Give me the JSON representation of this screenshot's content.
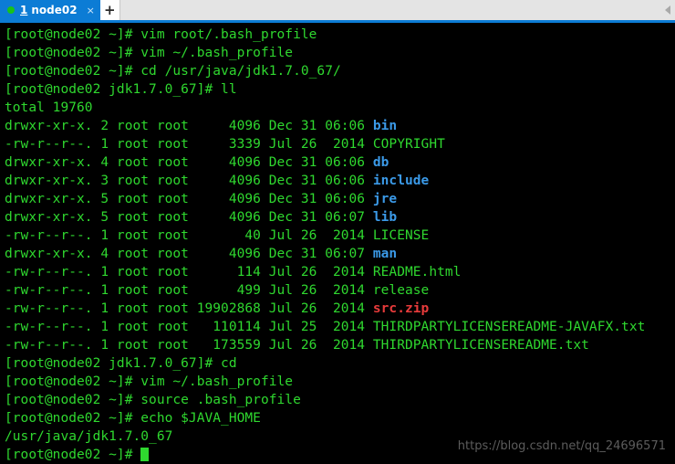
{
  "window": {
    "tabbar": {
      "tabs": [
        {
          "index": "1",
          "title": "node02",
          "close_label": "×",
          "status_icon": "green-dot"
        }
      ],
      "new_tab_label": "+",
      "scroll_arrow_icon": "chevron-left-icon"
    },
    "colors": {
      "tab_active_bg": "#0c7cd5",
      "tabbar_bg": "#e4e4e4",
      "terminal_bg": "#000000",
      "text_green": "#2fd82f",
      "dir_blue": "#3b9ae8",
      "archive_red": "#e83b3b",
      "status_dot": "#19c319"
    }
  },
  "terminal": {
    "prompt_user_host_home": "[root@node02 ~]# ",
    "prompt_user_host_jdk": "[root@node02 jdk1.7.0_67]# ",
    "lines": [
      {
        "text": "[root@node02 ~]# vim root/.bash_profile",
        "class": "g"
      },
      {
        "text": "[root@node02 ~]# vim ~/.bash_profile",
        "class": "g"
      },
      {
        "text": "[root@node02 ~]# cd /usr/java/jdk1.7.0_67/",
        "class": "g"
      },
      {
        "text": "[root@node02 jdk1.7.0_67]# ll",
        "class": "g"
      },
      {
        "text": "total 19760",
        "class": "g"
      }
    ],
    "listing": {
      "total_line": "total 19760",
      "rows": [
        {
          "perms": "drwxr-xr-x.",
          "links": "2",
          "owner": "root",
          "group": "root",
          "size": "4096",
          "month": "Dec",
          "day": "31",
          "time": "06:06",
          "name": "bin",
          "name_class": "b"
        },
        {
          "perms": "-rw-r--r--.",
          "links": "1",
          "owner": "root",
          "group": "root",
          "size": "3339",
          "month": "Jul",
          "day": "26",
          "time": "2014",
          "name": "COPYRIGHT",
          "name_class": "g"
        },
        {
          "perms": "drwxr-xr-x.",
          "links": "4",
          "owner": "root",
          "group": "root",
          "size": "4096",
          "month": "Dec",
          "day": "31",
          "time": "06:06",
          "name": "db",
          "name_class": "b"
        },
        {
          "perms": "drwxr-xr-x.",
          "links": "3",
          "owner": "root",
          "group": "root",
          "size": "4096",
          "month": "Dec",
          "day": "31",
          "time": "06:06",
          "name": "include",
          "name_class": "b"
        },
        {
          "perms": "drwxr-xr-x.",
          "links": "5",
          "owner": "root",
          "group": "root",
          "size": "4096",
          "month": "Dec",
          "day": "31",
          "time": "06:06",
          "name": "jre",
          "name_class": "b"
        },
        {
          "perms": "drwxr-xr-x.",
          "links": "5",
          "owner": "root",
          "group": "root",
          "size": "4096",
          "month": "Dec",
          "day": "31",
          "time": "06:07",
          "name": "lib",
          "name_class": "b"
        },
        {
          "perms": "-rw-r--r--.",
          "links": "1",
          "owner": "root",
          "group": "root",
          "size": "40",
          "month": "Jul",
          "day": "26",
          "time": "2014",
          "name": "LICENSE",
          "name_class": "g"
        },
        {
          "perms": "drwxr-xr-x.",
          "links": "4",
          "owner": "root",
          "group": "root",
          "size": "4096",
          "month": "Dec",
          "day": "31",
          "time": "06:07",
          "name": "man",
          "name_class": "b"
        },
        {
          "perms": "-rw-r--r--.",
          "links": "1",
          "owner": "root",
          "group": "root",
          "size": "114",
          "month": "Jul",
          "day": "26",
          "time": "2014",
          "name": "README.html",
          "name_class": "g"
        },
        {
          "perms": "-rw-r--r--.",
          "links": "1",
          "owner": "root",
          "group": "root",
          "size": "499",
          "month": "Jul",
          "day": "26",
          "time": "2014",
          "name": "release",
          "name_class": "g"
        },
        {
          "perms": "-rw-r--r--.",
          "links": "1",
          "owner": "root",
          "group": "root",
          "size": "19902868",
          "month": "Jul",
          "day": "26",
          "time": "2014",
          "name": "src.zip",
          "name_class": "r"
        },
        {
          "perms": "-rw-r--r--.",
          "links": "1",
          "owner": "root",
          "group": "root",
          "size": "110114",
          "month": "Jul",
          "day": "25",
          "time": "2014",
          "name": "THIRDPARTYLICENSEREADME-JAVAFX.txt",
          "name_class": "g"
        },
        {
          "perms": "-rw-r--r--.",
          "links": "1",
          "owner": "root",
          "group": "root",
          "size": "173559",
          "month": "Jul",
          "day": "26",
          "time": "2014",
          "name": "THIRDPARTYLICENSEREADME.txt",
          "name_class": "g"
        }
      ]
    },
    "trailing_lines": [
      {
        "text": "[root@node02 jdk1.7.0_67]# cd",
        "class": "g"
      },
      {
        "text": "[root@node02 ~]# vim ~/.bash_profile",
        "class": "g"
      },
      {
        "text": "[root@node02 ~]# source .bash_profile",
        "class": "g"
      },
      {
        "text": "[root@node02 ~]# echo $JAVA_HOME",
        "class": "g"
      },
      {
        "text": "/usr/java/jdk1.7.0_67",
        "class": "g"
      }
    ],
    "final_prompt": "[root@node02 ~]# ",
    "cursor": "block-cursor"
  },
  "watermark": {
    "text": "https://blog.csdn.net/qq_24696571"
  }
}
